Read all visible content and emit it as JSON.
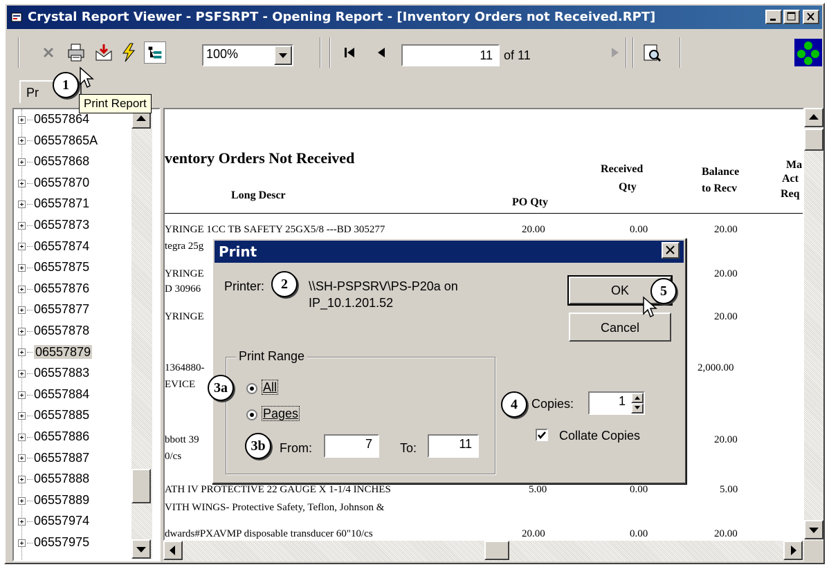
{
  "window": {
    "title": "Crystal Report Viewer - PSFSRPT - Opening Report - [Inventory Orders not Received.RPT]"
  },
  "toolbar": {
    "zoom": "100%",
    "current_page": "11",
    "page_total": "of 11",
    "print_tooltip": "Print Report",
    "icons": [
      "close-icon",
      "printer-icon",
      "export-icon",
      "refresh-icon",
      "tree-toggle-icon",
      "first-page-icon",
      "prev-page-icon",
      "next-page-icon",
      "search-icon",
      "crystal-logo-icon"
    ]
  },
  "tab": {
    "label": "Pr"
  },
  "tree": {
    "items": [
      "06557864",
      "06557865A",
      "06557868",
      "06557870",
      "06557871",
      "06557873",
      "06557874",
      "06557875",
      "06557876",
      "06557877",
      "06557878",
      "06557879",
      "06557883",
      "06557884",
      "06557885",
      "06557886",
      "06557887",
      "06557888",
      "06557889",
      "06557974",
      "06557975"
    ],
    "selected": "06557879"
  },
  "report": {
    "title": "ventory Orders Not Received",
    "columns": {
      "long_descr": "Long Descr",
      "po_qty": "PO Qty",
      "received_qty_1": "Received",
      "received_qty_2": "Qty",
      "balance_1": "Balance",
      "balance_2": "to Recv",
      "ma_1": "Ma",
      "ma_2": "Act",
      "ma_3": "Req"
    },
    "lines": [
      "YRINGE 1CC TB SAFETY 25GX5/8 ---BD 305277",
      "tegra 25g",
      "YRINGE",
      "D 30966",
      "YRINGE",
      "1364880-",
      "EVICE",
      "bbott 39",
      "0/cs",
      "ATH IV PROTECTIVE 22 GAUGE X 1-1/4 INCHES",
      "VITH WINGS- Protective Safety, Teflon, Johnson &",
      "dwards#PXAVMP disposable transducer 60\"10/cs"
    ],
    "po_values": [
      "20.00",
      "5.00",
      "20.00"
    ],
    "received_values": [
      "0.00",
      "0.00",
      "0.00"
    ],
    "balance_values": [
      "20.00",
      "20.00",
      "20.00",
      "2,000.00",
      "20.00",
      "5.00",
      "20.00"
    ]
  },
  "dialog": {
    "title": "Print",
    "printer_label": "Printer:",
    "printer_line1": "\\\\SH-PSPSRV\\PS-P20a on",
    "printer_line2": "IP_10.1.201.52",
    "ok": "OK",
    "cancel": "Cancel",
    "range_title": "Print Range",
    "all": "All",
    "pages": "Pages",
    "from_label": "From:",
    "from_value": "7",
    "to_label": "To:",
    "to_value": "11",
    "copies_label": "Copies:",
    "copies_value": "1",
    "collate": "Collate Copies"
  },
  "callouts": [
    "1",
    "2",
    "3a",
    "3b",
    "4",
    "5"
  ]
}
